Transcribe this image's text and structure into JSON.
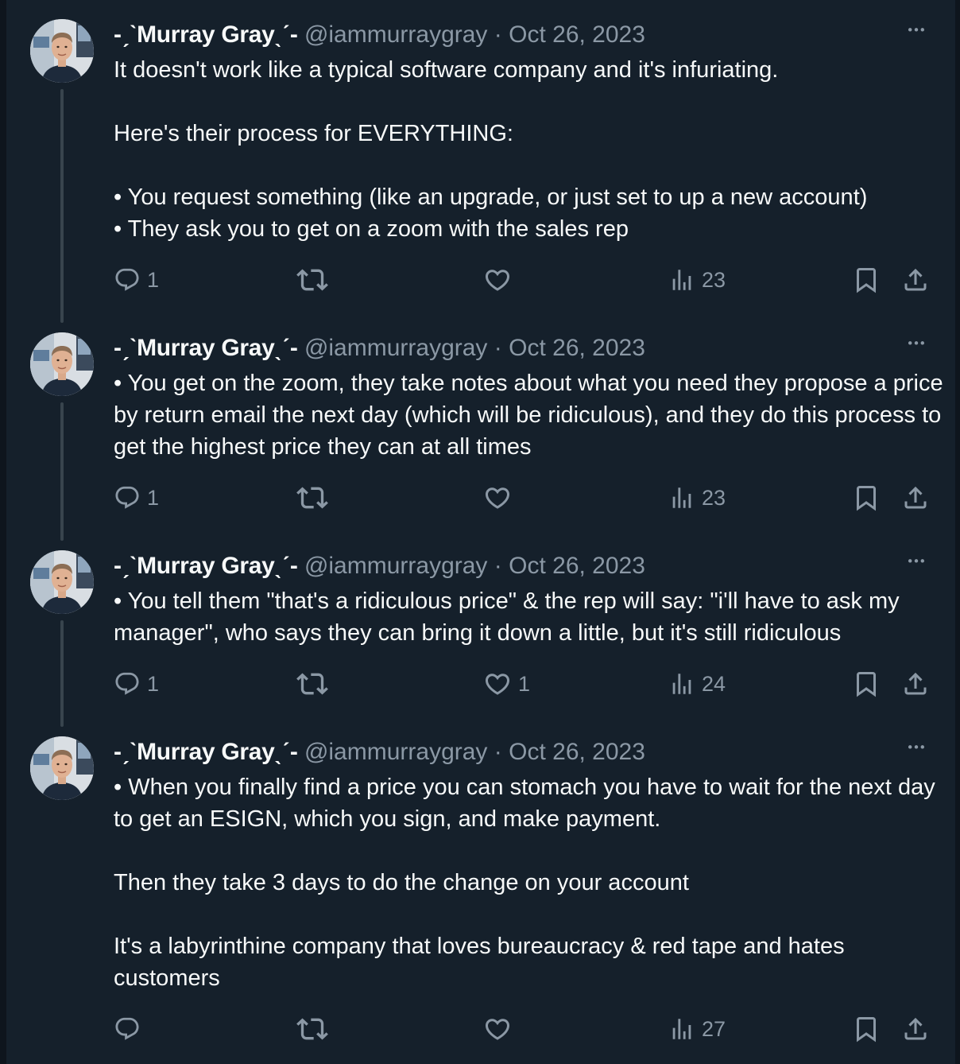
{
  "author": {
    "name": "-ˏˋMurray Grayˎˊ-",
    "handle": "@iammurraygray",
    "separator": "·",
    "avatar_icon": "avatar-photo-icon"
  },
  "colors": {
    "background": "#15202b",
    "text": "#f7f9f9",
    "secondary": "#8b98a5",
    "thread_line": "#38444d"
  },
  "tweets": [
    {
      "date": "Oct 26, 2023",
      "paragraphs": [
        "It doesn't work like a typical software company and it's infuriating.",
        "Here's their process for EVERYTHING:",
        "• You request something (like an upgrade, or just set to up a new account)\n• They ask you to get on a zoom with the sales rep"
      ],
      "replies": "1",
      "retweets": "",
      "likes": "",
      "views": "23"
    },
    {
      "date": "Oct 26, 2023",
      "paragraphs": [
        "• You get on the zoom, they take notes about what you need they propose a price by return email the next day (which will be ridiculous), and they do this process to get the highest price they can at all times"
      ],
      "replies": "1",
      "retweets": "",
      "likes": "",
      "views": "23"
    },
    {
      "date": "Oct 26, 2023",
      "paragraphs": [
        "• You tell them \"that's a ridiculous price\" & the rep will say: \"i'll have to ask my manager\", who says they can bring it down a little, but it's still ridiculous"
      ],
      "replies": "1",
      "retweets": "",
      "likes": "1",
      "views": "24"
    },
    {
      "date": "Oct 26, 2023",
      "paragraphs": [
        "• When you finally find a price you can stomach you have to wait for the next day to get an ESIGN, which you sign, and make payment.",
        "Then they take 3 days to do the change on your account",
        "It's a labyrinthine company that loves bureaucracy & red tape and hates customers"
      ],
      "replies": "",
      "retweets": "",
      "likes": "",
      "views": "27"
    }
  ]
}
